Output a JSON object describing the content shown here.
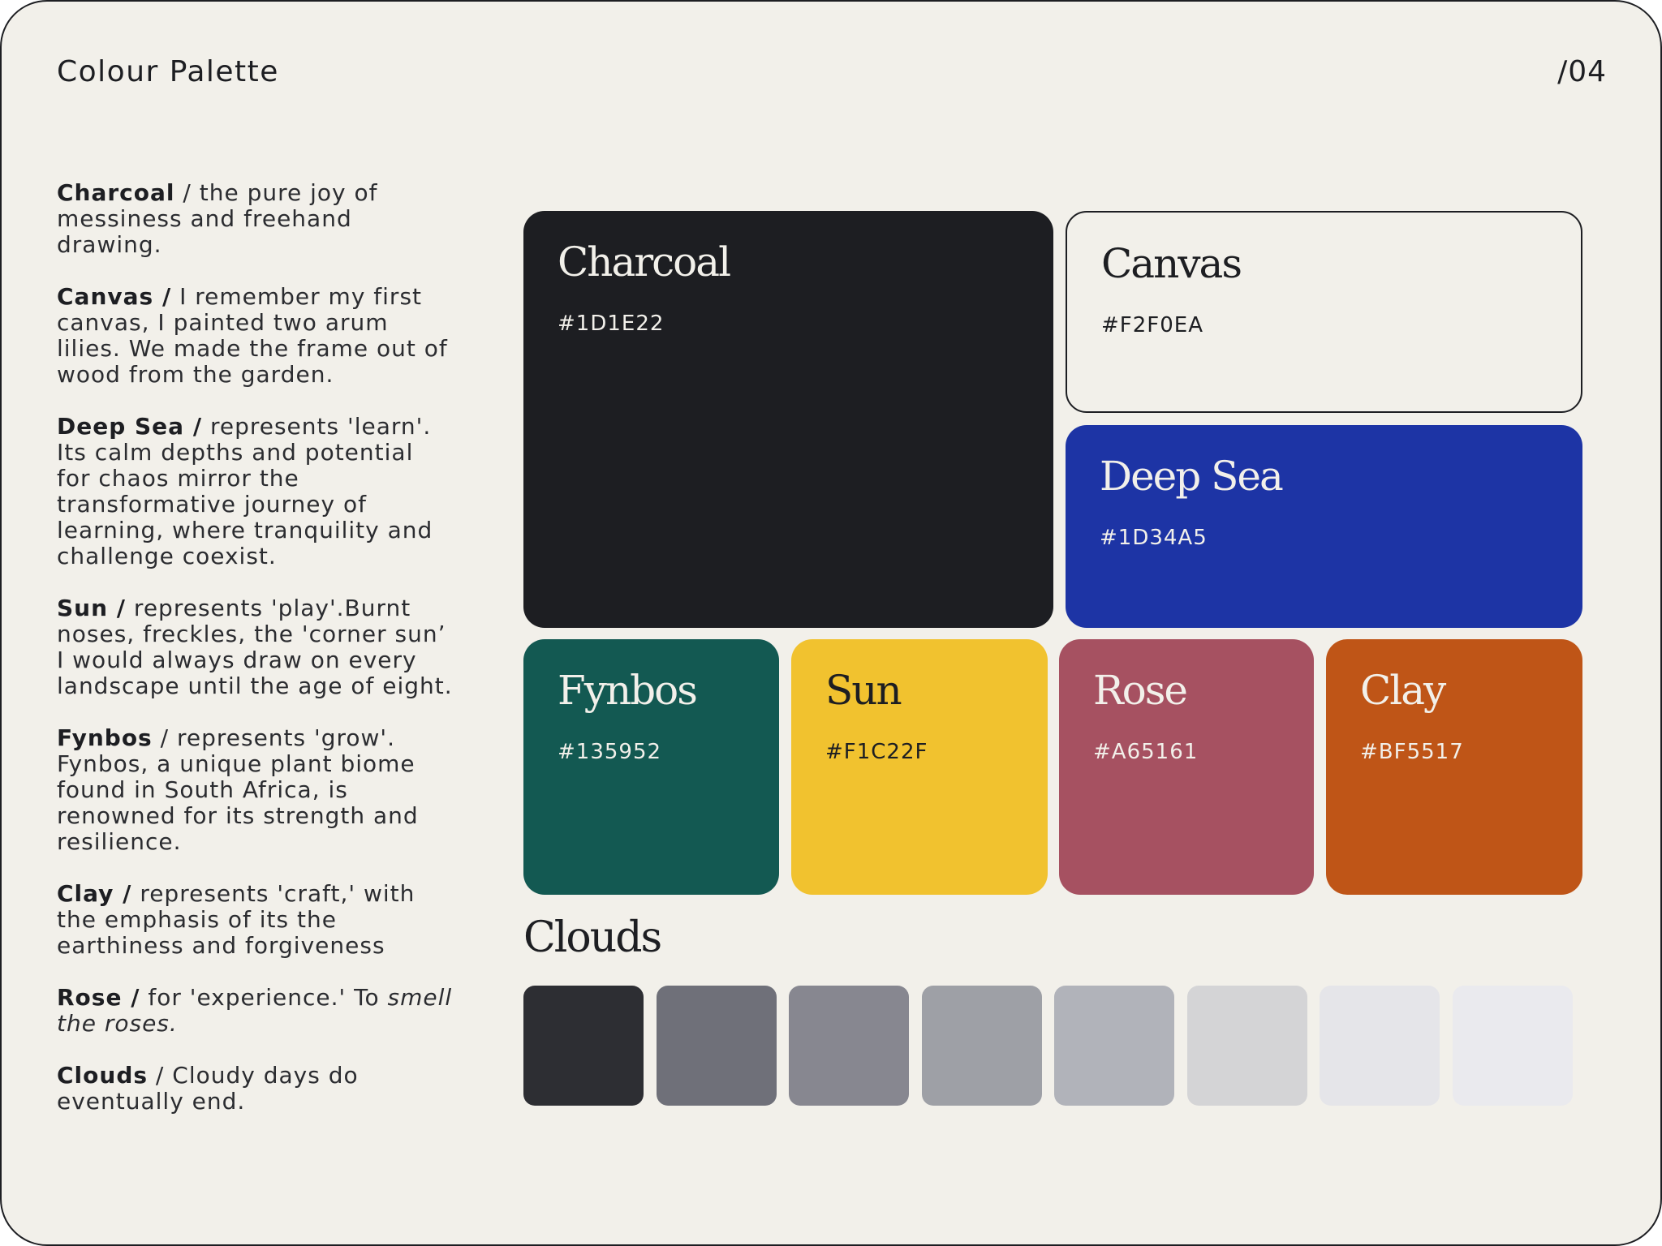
{
  "header": {
    "title": "Colour Palette",
    "page_number": "/04"
  },
  "descriptions": [
    {
      "name": "Charcoal",
      "separator": " / ",
      "text": "the pure joy of messiness and freehand drawing."
    },
    {
      "name": "Canvas /",
      "separator": " ",
      "text": "I remember my first canvas, I painted two arum lilies. We made the frame out of wood from the garden."
    },
    {
      "name": "Deep Sea /",
      "separator": " ",
      "text": "represents 'learn'. Its calm depths and potential for chaos mirror the transformative journey of learning, where tranquility and challenge coexist."
    },
    {
      "name": "Sun /",
      "separator": " ",
      "text": "represents 'play'.Burnt noses, freckles, the 'corner sun’ I would always draw on every landscape until the age of eight."
    },
    {
      "name": "Fynbos",
      "separator": " / ",
      "text": "represents 'grow'. Fynbos, a unique plant biome found in South Africa, is renowned for its strength and resilience."
    },
    {
      "name": "Clay /",
      "separator": " ",
      "text": "represents 'craft,' with the emphasis of its the earthiness and forgiveness"
    },
    {
      "name": "Rose /",
      "separator": " ",
      "text": "for 'experience.' To ",
      "emphasis": "smell the roses."
    },
    {
      "name": "Clouds",
      "separator": " / ",
      "text": "Cloudy days do eventually end."
    }
  ],
  "swatches": {
    "charcoal": {
      "name": "Charcoal",
      "hex": "#1D1E22",
      "color": "#1D1E22"
    },
    "canvas": {
      "name": "Canvas",
      "hex": "#F2F0EA",
      "color": "#F2F0EA"
    },
    "deep_sea": {
      "name": "Deep Sea",
      "hex": "#1D34A5",
      "color": "#1D34A5"
    },
    "fynbos": {
      "name": "Fynbos",
      "hex": "#135952",
      "color": "#135952"
    },
    "sun": {
      "name": "Sun",
      "hex": "#F1C22F",
      "color": "#F1C22F"
    },
    "rose": {
      "name": "Rose",
      "hex": "#A65161",
      "color": "#A65161"
    },
    "clay": {
      "name": "Clay",
      "hex": "#BF5517",
      "color": "#BF5517"
    }
  },
  "clouds": {
    "heading": "Clouds",
    "colors": [
      "#2D2E33",
      "#6F7079",
      "#878790",
      "#9EA0A6",
      "#B1B3BA",
      "#D4D4D6",
      "#E5E5E9",
      "#EAEAEE"
    ]
  }
}
